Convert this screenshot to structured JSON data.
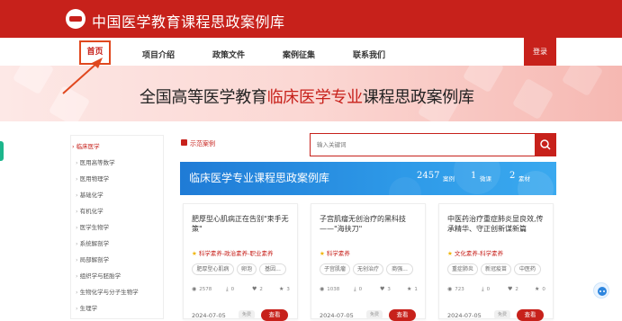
{
  "header": {
    "title": "中国医学教育课程思政案例库"
  },
  "nav": {
    "items": [
      {
        "label": "首页"
      },
      {
        "label": "项目介绍"
      },
      {
        "label": "政策文件"
      },
      {
        "label": "案例征集"
      },
      {
        "label": "联系我们"
      }
    ],
    "login_label": "登录"
  },
  "banner": {
    "title_prefix": "全国高等医学教育",
    "title_highlight": "临床医学专业",
    "title_suffix": "课程思政案例库"
  },
  "sidebar": {
    "items": [
      {
        "label": "临床医学"
      },
      {
        "label": "医用高等数学"
      },
      {
        "label": "医用物理学"
      },
      {
        "label": "基础化学"
      },
      {
        "label": "有机化学"
      },
      {
        "label": "医学生物学"
      },
      {
        "label": "系统解剖学"
      },
      {
        "label": "局部解剖学"
      },
      {
        "label": "组织学与胚胎学"
      },
      {
        "label": "生物化学与分子生物学"
      },
      {
        "label": "生理学"
      }
    ]
  },
  "filter": {
    "label": "示范案例"
  },
  "search": {
    "placeholder": "输入关键词"
  },
  "library": {
    "title": "临床医学专业课程思政案例库",
    "stats": [
      {
        "value": "2457",
        "label": "案例"
      },
      {
        "value": "1",
        "label": "微课"
      },
      {
        "value": "2",
        "label": "素材"
      }
    ]
  },
  "cards": [
    {
      "title": "肥厚型心肌病正在告别\"束手无策\"",
      "tag": "科学素养-政治素养-职业素养",
      "chips": [
        "肥厚型心肌病",
        "卵泡",
        "基因..."
      ],
      "views": "2578",
      "downloads": "0",
      "likes": "2",
      "stars": "3",
      "date": "2024-07-05",
      "badge": "免费",
      "button": "查看"
    },
    {
      "title": "子宫肌瘤无创治疗的黑科技——\"海扶刀\"",
      "tag": "科学素养",
      "chips": [
        "子宫肌瘤",
        "无创治疗",
        "商强..."
      ],
      "views": "1038",
      "downloads": "0",
      "likes": "3",
      "stars": "1",
      "date": "2024-07-05",
      "badge": "免费",
      "button": "查看"
    },
    {
      "title": "中医药治疗重症肺炎显良效,传承精华、守正创新谋新篇",
      "tag": "文化素养-科学素养",
      "chips": [
        "重症肺炎",
        "新冠疫苗",
        "中医药"
      ],
      "views": "723",
      "downloads": "0",
      "likes": "2",
      "stars": "0",
      "date": "2024-07-05",
      "badge": "免费",
      "button": "查看"
    }
  ],
  "colors": {
    "primary": "#c7211b",
    "accent_blue": "#1f7bd6",
    "star": "#f0b400"
  }
}
